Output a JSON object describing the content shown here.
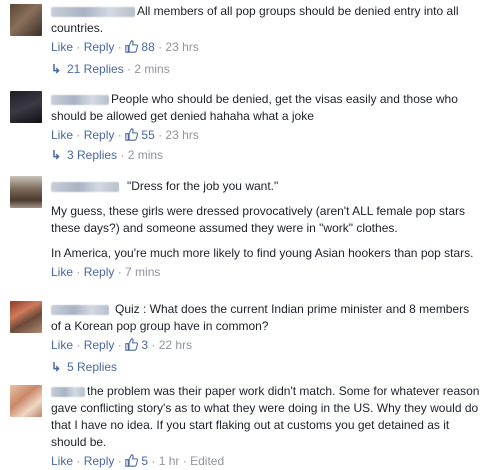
{
  "comments": [
    {
      "text_lines": [
        "All members of all pop groups should be denied entry into all countries."
      ],
      "like_label": "Like",
      "reply_label": "Reply",
      "likes": "88",
      "time": "23 hrs",
      "replies_label": "21 Replies",
      "replies_time": "2 mins"
    },
    {
      "text_lines": [
        "People who should be denied, get the visas easily and those who should be allowed get denied hahaha what a joke"
      ],
      "like_label": "Like",
      "reply_label": "Reply",
      "likes": "55",
      "time": "23 hrs",
      "replies_label": "3 Replies",
      "replies_time": "2 mins"
    },
    {
      "paragraphs": [
        "\"Dress for the job you want.\"",
        "My guess, these girls were dressed provocatively (aren't ALL female pop stars these days?) and someone assumed they were in \"work\" clothes.",
        "In America, you're much more likely to find young Asian hookers than pop stars."
      ],
      "like_label": "Like",
      "reply_label": "Reply",
      "time": "7 mins"
    },
    {
      "text_lines": [
        "Quiz : What does the current Indian prime minister and 8 members of a Korean pop group have in common?"
      ],
      "like_label": "Like",
      "reply_label": "Reply",
      "likes": "3",
      "time": "22 hrs",
      "replies_label": "5 Replies"
    },
    {
      "text_lines": [
        "the problem was their paper work didn't match. Some for whatever reason gave conflicting story's as to what they were doing in the US. Why they would do that I have no idea. If you start flaking out at customs you get detained as it should be."
      ],
      "like_label": "Like",
      "reply_label": "Reply",
      "likes": "5",
      "time": "1 hr",
      "edited": "Edited"
    }
  ],
  "icons": {
    "like": "thumbs-up-icon",
    "reply_arrow": "reply-arrow-icon"
  },
  "colors": {
    "link": "#4b67a1",
    "meta": "#90949c",
    "text": "#1d2129"
  }
}
